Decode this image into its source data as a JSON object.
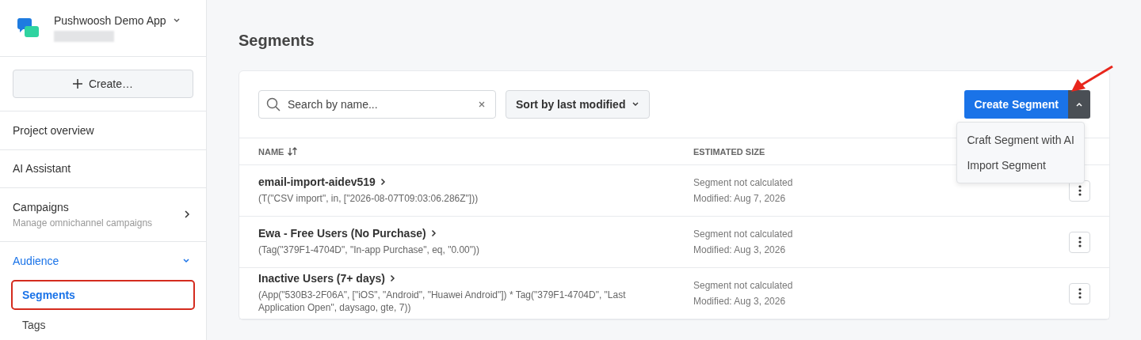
{
  "sidebar": {
    "app_name": "Pushwoosh Demo App",
    "create_button": "Create…",
    "items": [
      {
        "label": "Project overview",
        "kind": "link"
      },
      {
        "label": "AI Assistant",
        "kind": "link"
      },
      {
        "label": "Campaigns",
        "subtitle": "Manage omnichannel campaigns",
        "kind": "submenu"
      },
      {
        "label": "Audience",
        "kind": "group",
        "expanded": true,
        "selected": true,
        "children": [
          {
            "label": "Segments",
            "selected": true
          },
          {
            "label": "Tags",
            "selected": false
          }
        ]
      }
    ]
  },
  "page": {
    "title": "Segments"
  },
  "toolbar": {
    "search": {
      "placeholder": "Search by name..."
    },
    "sort": "Sort by last modified",
    "create_button": "Create Segment",
    "menu_open": true,
    "menu_items": [
      "Craft Segment with AI",
      "Import Segment"
    ]
  },
  "table": {
    "columns": [
      "NAME",
      "ESTIMATED SIZE"
    ],
    "rows": [
      {
        "name": "email-import-aidev519",
        "rule": "(T(\"CSV import\", in, [\"2026-08-07T09:03:06.286Z\"]))",
        "size": "Segment not calculated",
        "modified": "Modified: Aug 7, 2026"
      },
      {
        "name": "Ewa - Free Users (No Purchase)",
        "rule": "(Tag(\"379F1-4704D\", \"In-app Purchase\", eq, \"0.00\"))",
        "size": "Segment not calculated",
        "modified": "Modified: Aug 3, 2026"
      },
      {
        "name": "Inactive Users (7+ days)",
        "rule": "(App(\"530B3-2F06A\", [\"iOS\", \"Android\", \"Huawei Android\"]) * Tag(\"379F1-4704D\", \"Last Application Open\", daysago, gte, 7))",
        "size": "Segment not calculated",
        "modified": "Modified: Aug 3, 2026"
      }
    ]
  }
}
